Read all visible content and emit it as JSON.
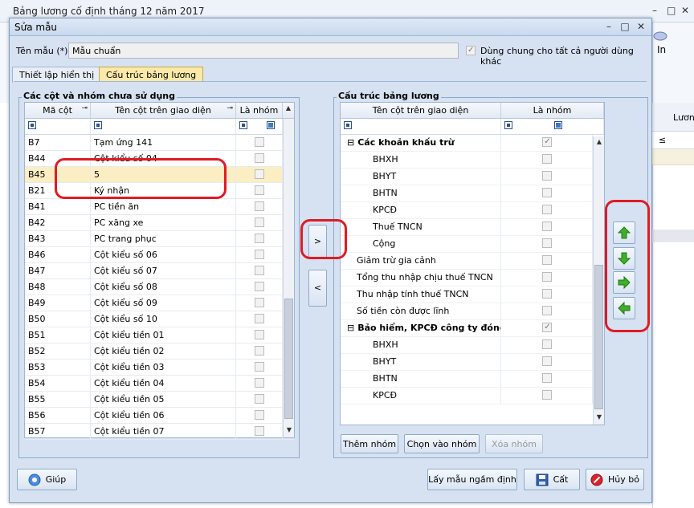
{
  "background_window": {
    "title": "Bảng lương cố định tháng 12 năm 2017",
    "minimize": "–",
    "maximize": "□",
    "close": "✕",
    "ribbon_label": "In",
    "column_header": "Lương",
    "filter_symbol": "≤"
  },
  "dialog": {
    "title": "Sửa mẫu",
    "btn_minimize": "–",
    "btn_maximize": "□",
    "btn_close": "✕",
    "template_name_label": "Tên mẫu (*)",
    "template_name_value": "Mẫu chuẩn",
    "share_label": "Dùng chung cho tất cả  người dùng khác",
    "share_checked": true,
    "tabs": [
      {
        "label": "Thiết lập hiển thị",
        "active": false
      },
      {
        "label": "Cấu trúc bảng lương",
        "active": true
      }
    ]
  },
  "left_panel": {
    "title": "Các cột và nhóm chưa sử dụng",
    "columns": [
      "Mã cột",
      "Tên cột trên giao diện",
      "Là nhóm"
    ],
    "rows": [
      {
        "code": "B7",
        "name": "Tạm ứng 141",
        "group": false
      },
      {
        "code": "B44",
        "name": "Cột kiểu số 04",
        "group": false
      },
      {
        "code": "B45",
        "name": "5",
        "group": false,
        "selected": true
      },
      {
        "code": "B21",
        "name": "Ký nhận",
        "group": false
      },
      {
        "code": "B41",
        "name": "PC tiền ăn",
        "group": false
      },
      {
        "code": "B42",
        "name": "PC xăng xe",
        "group": false
      },
      {
        "code": "B43",
        "name": "PC trang phục",
        "group": false
      },
      {
        "code": "B46",
        "name": "Cột kiểu số 06",
        "group": false
      },
      {
        "code": "B47",
        "name": "Cột kiểu số 07",
        "group": false
      },
      {
        "code": "B48",
        "name": "Cột kiểu số 08",
        "group": false
      },
      {
        "code": "B49",
        "name": "Cột kiểu số 09",
        "group": false
      },
      {
        "code": "B50",
        "name": "Cột kiểu số 10",
        "group": false
      },
      {
        "code": "B51",
        "name": "Cột kiểu tiền 01",
        "group": false
      },
      {
        "code": "B52",
        "name": "Cột kiểu tiền 02",
        "group": false
      },
      {
        "code": "B53",
        "name": "Cột kiểu tiền 03",
        "group": false
      },
      {
        "code": "B54",
        "name": "Cột kiểu tiền 04",
        "group": false
      },
      {
        "code": "B55",
        "name": "Cột kiểu tiền 05",
        "group": false
      },
      {
        "code": "B56",
        "name": "Cột kiểu tiền 06",
        "group": false
      },
      {
        "code": "B57",
        "name": "Cột kiểu tiền 07",
        "group": false
      }
    ]
  },
  "move_buttons": {
    "right": ">",
    "left": "<"
  },
  "right_panel": {
    "title": "Cấu trúc bảng lương",
    "columns": [
      "Tên cột trên giao diện",
      "Là nhóm"
    ],
    "rows": [
      {
        "name": "Các khoản khấu trừ",
        "level": 0,
        "group": true,
        "bold": true,
        "expander": "⊟"
      },
      {
        "name": "BHXH",
        "level": 2,
        "group": false
      },
      {
        "name": "BHYT",
        "level": 2,
        "group": false
      },
      {
        "name": "BHTN",
        "level": 2,
        "group": false
      },
      {
        "name": "KPCĐ",
        "level": 2,
        "group": false
      },
      {
        "name": "Thuế TNCN",
        "level": 2,
        "group": false
      },
      {
        "name": "Cộng",
        "level": 2,
        "group": false
      },
      {
        "name": "Giảm trừ gia cảnh",
        "level": 1,
        "group": false
      },
      {
        "name": "Tổng thu nhập chịu thuế TNCN",
        "level": 1,
        "group": false
      },
      {
        "name": "Thu nhập tính thuế TNCN",
        "level": 1,
        "group": false
      },
      {
        "name": "Số tiền còn được lĩnh",
        "level": 1,
        "group": false
      },
      {
        "name": "Bảo hiểm, KPCĐ công ty đóng",
        "level": 0,
        "group": true,
        "bold": true,
        "expander": "⊟"
      },
      {
        "name": "BHXH",
        "level": 2,
        "group": false
      },
      {
        "name": "BHYT",
        "level": 2,
        "group": false
      },
      {
        "name": "BHTN",
        "level": 2,
        "group": false
      },
      {
        "name": "KPCĐ",
        "level": 2,
        "group": false
      }
    ],
    "buttons": {
      "add_group": "Thêm nhóm",
      "choose_group": "Chọn vào nhóm",
      "delete_group": "Xóa nhóm"
    }
  },
  "footer": {
    "help": "Giúp",
    "default_template": "Lấy mẫu ngầm định",
    "save": "Cất",
    "cancel": "Hủy bỏ"
  },
  "colors": {
    "annotation_red": "#e01b24",
    "dialog_bg": "#d6e2f1",
    "active_tab": "#fce9a8",
    "selected_row": "#fbeec2",
    "arrow_green": "#3fae29"
  }
}
